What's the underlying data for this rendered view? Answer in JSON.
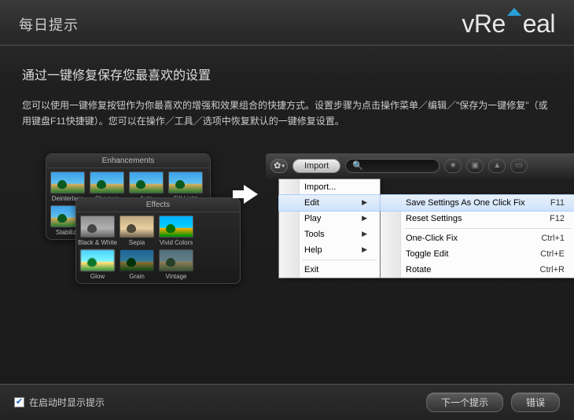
{
  "header": {
    "title": "每日提示",
    "logo_text": "vReveal"
  },
  "tip": {
    "heading": "通过一键修复保存您最喜欢的设置",
    "body": "您可以使用一键修复按钮作为你最喜欢的增强和效果组合的快捷方式。设置步骤为点击操作菜单／编辑／\"保存为一键修复\"（或用键盘F11快捷键）。您可以在操作／工具／选项中恢复默认的一键修复设置。"
  },
  "panels": {
    "enhancements": {
      "title": "Enhancements",
      "items": [
        "Deinterlace",
        "Sharpen",
        "Auto",
        "Fill Light",
        "Stabilize"
      ]
    },
    "effects": {
      "title": "Effects",
      "items": [
        "Black & White",
        "Sepia",
        "Vivid Colors",
        "Glow",
        "Grain",
        "Vintage"
      ]
    }
  },
  "toolbar": {
    "import_label": "Import",
    "search_placeholder": ""
  },
  "menu_gear": {
    "items": [
      {
        "label": "Import...",
        "submenu": false
      },
      {
        "label": "Edit",
        "submenu": true,
        "highlight": true
      },
      {
        "label": "Play",
        "submenu": true
      },
      {
        "label": "Tools",
        "submenu": true
      },
      {
        "label": "Help",
        "submenu": true
      },
      {
        "label": "Exit",
        "submenu": false
      }
    ]
  },
  "menu_edit": {
    "items": [
      {
        "label": "Save Settings As One Click Fix",
        "shortcut": "F11",
        "highlight": true
      },
      {
        "label": "Reset Settings",
        "shortcut": "F12"
      },
      {
        "sep": true
      },
      {
        "label": "One-Click Fix",
        "shortcut": "Ctrl+1"
      },
      {
        "label": "Toggle Edit",
        "shortcut": "Ctrl+E"
      },
      {
        "label": "Rotate",
        "shortcut": "Ctrl+R"
      }
    ]
  },
  "footer": {
    "checkbox_label": "在启动时显示提示",
    "checkbox_checked": true,
    "next_label": "下一个提示",
    "close_label": "错误"
  }
}
